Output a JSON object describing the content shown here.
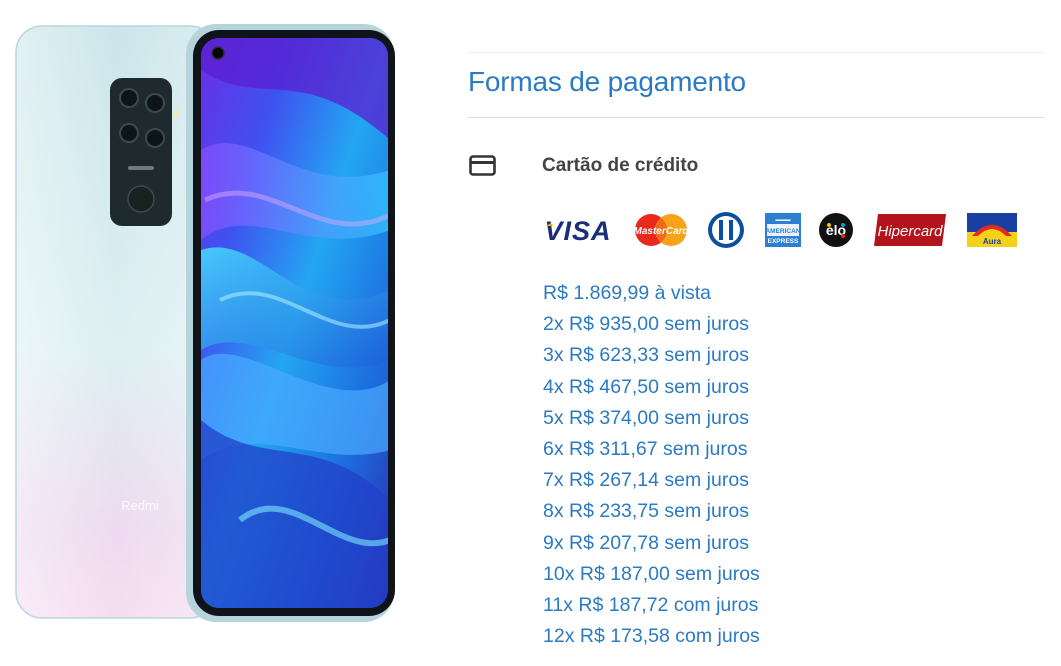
{
  "product": {
    "image_alt": "Redmi Note 9 smartphone",
    "back_brand_text": "Redmi",
    "colors": {
      "body_top": "#c9e6ec",
      "body_bottom": "#f2d9ee",
      "screen_dark": "#1a1030",
      "screen_blue": "#2fa8f0",
      "screen_purple": "#7b3cff"
    }
  },
  "payment": {
    "title": "Formas de pagamento",
    "method": {
      "label": "Cartão de crédito",
      "icon": "credit-card-icon"
    },
    "brands": [
      {
        "name": "VISA",
        "icon": "visa-logo"
      },
      {
        "name": "MasterCard",
        "icon": "mastercard-logo"
      },
      {
        "name": "Diners Club",
        "icon": "diners-logo"
      },
      {
        "name": "American Express",
        "icon": "amex-logo"
      },
      {
        "name": "elo",
        "icon": "elo-logo"
      },
      {
        "name": "Hipercard",
        "icon": "hipercard-logo"
      },
      {
        "name": "Aura",
        "icon": "aura-logo"
      }
    ],
    "installments": [
      "R$ 1.869,99 à vista",
      "2x R$ 935,00 sem juros",
      "3x R$ 623,33 sem juros",
      "4x R$ 467,50 sem juros",
      "5x R$ 374,00 sem juros",
      "6x R$ 311,67 sem juros",
      "7x R$ 267,14 sem juros",
      "8x R$ 233,75 sem juros",
      "9x R$ 207,78 sem juros",
      "10x R$ 187,00 sem juros",
      "11x R$ 187,72 com juros",
      "12x R$ 173,58 com juros"
    ],
    "colors": {
      "accent": "#2b7ac4",
      "label": "#444444"
    }
  }
}
